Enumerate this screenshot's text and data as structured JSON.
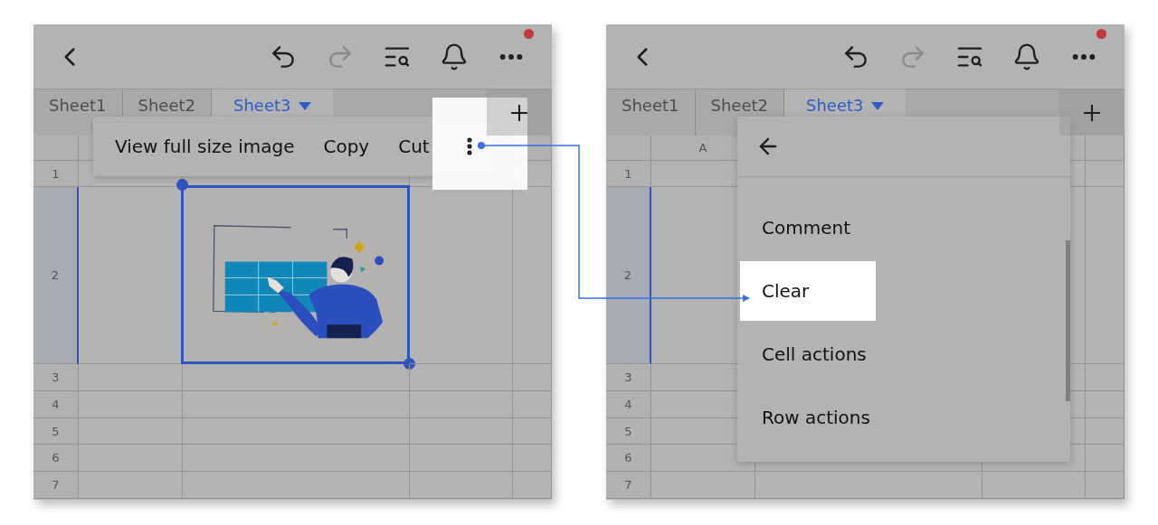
{
  "panels": [
    {
      "toolbar": {
        "redo_disabled": true,
        "more_badge": true
      },
      "tabs": [
        {
          "label": "Sheet1",
          "selected": false
        },
        {
          "label": "Sheet2",
          "selected": false
        },
        {
          "label": "Sheet3",
          "selected": true
        }
      ],
      "rows": [
        {
          "label": "1",
          "selected": false
        },
        {
          "label": "2",
          "selected": true
        },
        {
          "label": "3",
          "selected": false
        },
        {
          "label": "4",
          "selected": false
        },
        {
          "label": "5",
          "selected": false
        },
        {
          "label": "6",
          "selected": false
        },
        {
          "label": "7",
          "selected": false
        }
      ],
      "image": {
        "kind": "picture",
        "selected": true
      },
      "popup": {
        "kind": "action_bar",
        "actions": [
          "View full size image",
          "Copy",
          "Cut"
        ],
        "more_highlighted": true
      }
    },
    {
      "toolbar": {
        "redo_disabled": true,
        "more_badge": true
      },
      "tabs": [
        {
          "label": "Sheet1",
          "selected": false
        },
        {
          "label": "Sheet2",
          "selected": false
        },
        {
          "label": "Sheet3",
          "selected": true
        }
      ],
      "column_headers": [
        "A"
      ],
      "rows": [
        {
          "label": "1",
          "selected": false
        },
        {
          "label": "2",
          "selected": true
        },
        {
          "label": "3",
          "selected": false
        },
        {
          "label": "4",
          "selected": false
        },
        {
          "label": "5",
          "selected": false
        },
        {
          "label": "6",
          "selected": false
        },
        {
          "label": "7",
          "selected": false
        }
      ],
      "popup": {
        "kind": "menu",
        "items": [
          {
            "label": "Comment",
            "highlighted": false
          },
          {
            "label": "Clear",
            "highlighted": true
          },
          {
            "label": "Cell actions",
            "highlighted": false
          },
          {
            "label": "Row actions",
            "highlighted": false
          }
        ]
      }
    }
  ]
}
